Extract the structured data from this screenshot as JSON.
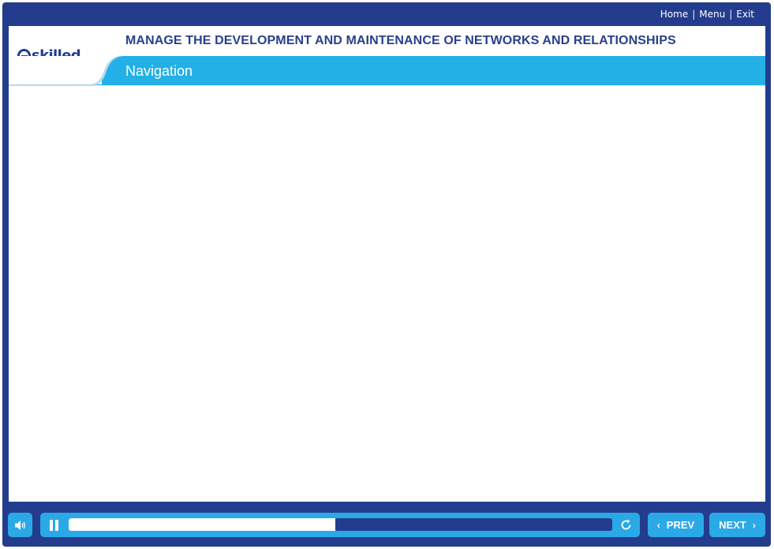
{
  "nav": {
    "home": "Home",
    "menu": "Menu",
    "exit": "Exit",
    "separator": "|"
  },
  "header": {
    "logo_text": "skilled",
    "course_title": "MANAGE THE DEVELOPMENT AND MAINTENANCE OF NETWORKS AND RELATIONSHIPS",
    "page_title": "Navigation"
  },
  "player": {
    "progress_fraction": 0.49,
    "audio_icon": "speaker-icon",
    "pause_icon": "pause-icon",
    "replay_icon": "replay-icon"
  },
  "buttons": {
    "prev_label": "PREV",
    "next_label": "NEXT",
    "prev_chevron": "‹",
    "next_chevron": "›"
  },
  "colors": {
    "frame": "#233c8e",
    "accent": "#2aa9e6",
    "banner": "#22b0e6",
    "title": "#2a3f8c"
  }
}
